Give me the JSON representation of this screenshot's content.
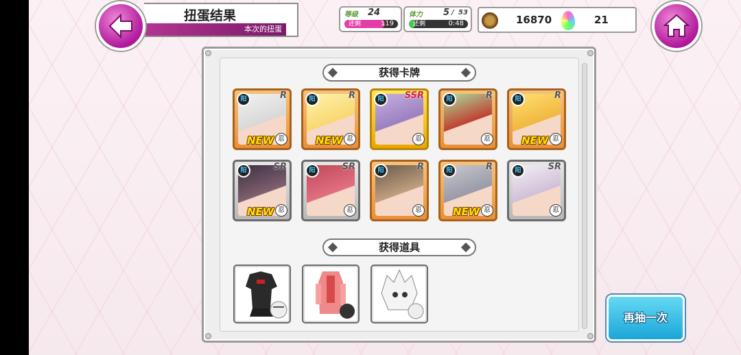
{
  "header": {
    "title": "扭蛋结果",
    "subtitle": "本次的扭蛋"
  },
  "stats": {
    "level_label": "等级",
    "level_value": "24",
    "level_remain_label": "还剩",
    "level_remain_value": "119",
    "level_progress": 0.75,
    "stamina_label": "体力",
    "stamina_value": "5",
    "stamina_max": "53",
    "stamina_remain_label": "还剩",
    "stamina_remain_value": "0:48",
    "stamina_progress": 0.1
  },
  "currency": {
    "coins": "16870",
    "gems": "21"
  },
  "sections": {
    "cards_title": "获得卡牌",
    "items_title": "获得道具"
  },
  "cards": [
    {
      "rarity": "R",
      "attr": "阳",
      "is_new": true,
      "kanji": "忍",
      "new_label": "NEW"
    },
    {
      "rarity": "R",
      "attr": "阳",
      "is_new": true,
      "kanji": "忍",
      "new_label": "NEW"
    },
    {
      "rarity": "SSR",
      "attr": "阳",
      "is_new": false,
      "kanji": "忍",
      "new_label": ""
    },
    {
      "rarity": "R",
      "attr": "阳",
      "is_new": false,
      "kanji": "忍",
      "new_label": ""
    },
    {
      "rarity": "R",
      "attr": "阳",
      "is_new": true,
      "kanji": "忍",
      "new_label": "NEW"
    },
    {
      "rarity": "SR",
      "attr": "阳",
      "is_new": true,
      "kanji": "忍",
      "new_label": "NEW"
    },
    {
      "rarity": "SR",
      "attr": "阳",
      "is_new": false,
      "kanji": "忍",
      "new_label": ""
    },
    {
      "rarity": "R",
      "attr": "阳",
      "is_new": false,
      "kanji": "忍",
      "new_label": ""
    },
    {
      "rarity": "R",
      "attr": "阳",
      "is_new": true,
      "kanji": "忍",
      "new_label": "NEW"
    },
    {
      "rarity": "SR",
      "attr": "阳",
      "is_new": false,
      "kanji": "忍",
      "new_label": ""
    }
  ],
  "items": [
    {
      "icon": "outfit-icon"
    },
    {
      "icon": "bodysuit-icon"
    },
    {
      "icon": "hair-icon"
    }
  ],
  "buttons": {
    "redraw": "再抽一次"
  },
  "colors": {
    "accent_pink": "#b0189a",
    "redraw_blue": "#1aa6d8"
  }
}
